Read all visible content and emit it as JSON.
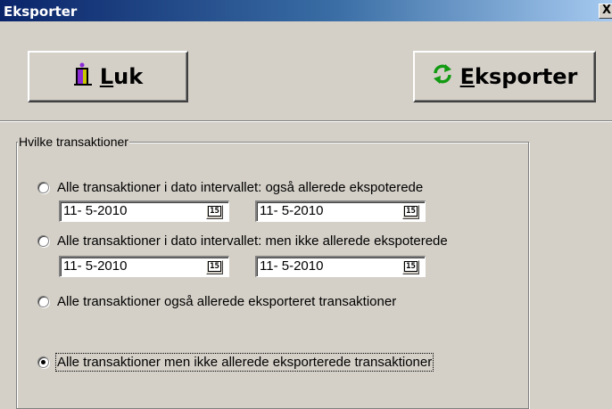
{
  "window": {
    "title": "Eksporter",
    "close_glyph": "X"
  },
  "toolbar": {
    "close_button": {
      "label_underlined": "L",
      "label_rest": "uk",
      "icon": "door-exit-icon"
    },
    "export_button": {
      "label_underlined": "E",
      "label_rest": "ksporter",
      "icon": "refresh-arrows-icon"
    }
  },
  "group": {
    "title": "Hvilke transaktioner",
    "options": [
      {
        "label": "Alle transaktioner i dato intervallet: også allerede ekspoterede",
        "checked": false
      },
      {
        "label": "Alle transaktioner i dato intervallet: men ikke allerede ekspoterede",
        "checked": false
      },
      {
        "label": "Alle transaktioner også allerede eksporteret transaktioner",
        "checked": false
      },
      {
        "label": "Alle transaktioner men ikke allerede eksporterede transaktioner",
        "checked": true
      }
    ],
    "range1": {
      "from": "11- 5-2010",
      "to": "11- 5-2010"
    },
    "range2": {
      "from": "11- 5-2010",
      "to": "11- 5-2010"
    },
    "calendar_glyph": "15"
  },
  "colors": {
    "face": "#d4d0c8",
    "title_start": "#0a246a",
    "title_end": "#a6caf0",
    "refresh_icon": "#129a12"
  }
}
